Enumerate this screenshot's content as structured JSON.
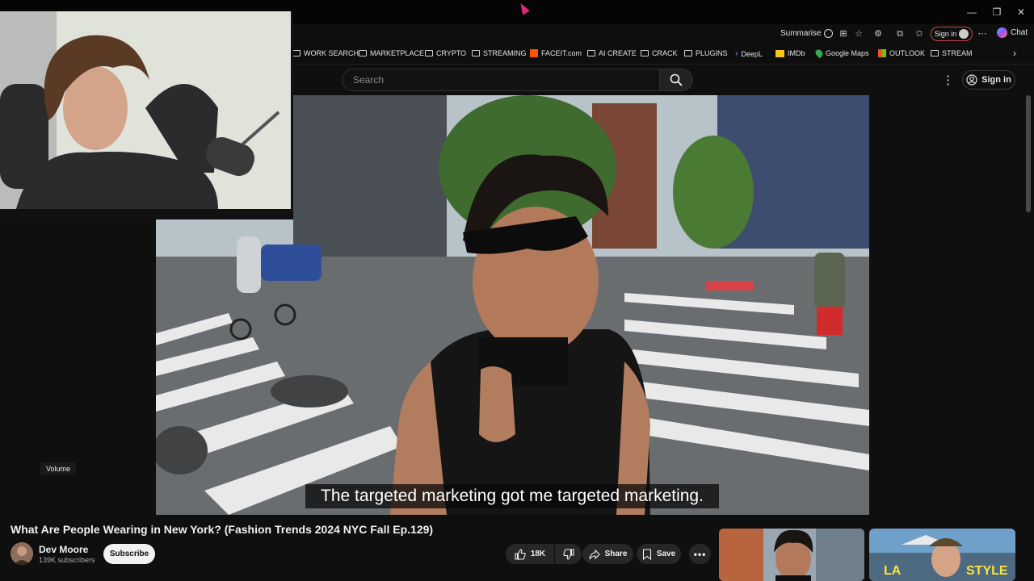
{
  "browser": {
    "toolbar": {
      "summarise_label": "Summarise",
      "signin_label": "Sign in",
      "chat_label": "Chat"
    },
    "bookmarks": [
      {
        "label": "WORK SEARCH",
        "icon": "folder-icon"
      },
      {
        "label": "MARKETPLACE",
        "icon": "folder-icon"
      },
      {
        "label": "CRYPTO",
        "icon": "folder-icon"
      },
      {
        "label": "STREAMING",
        "icon": "folder-icon"
      },
      {
        "label": "FACEIT.com",
        "icon": "faceit-icon"
      },
      {
        "label": "AI CREATE",
        "icon": "folder-icon"
      },
      {
        "label": "CRACK",
        "icon": "folder-icon"
      },
      {
        "label": "PLUGINS",
        "icon": "folder-icon"
      },
      {
        "label": "DeepL",
        "icon": "deepl-icon"
      },
      {
        "label": "IMDb",
        "icon": "imdb-icon"
      },
      {
        "label": "Google Maps",
        "icon": "maps-icon"
      },
      {
        "label": "OUTLOOK",
        "icon": "outlook-icon"
      },
      {
        "label": "STREAM",
        "icon": "folder-icon"
      }
    ]
  },
  "youtube": {
    "search_placeholder": "Search",
    "signin_label": "Sign in",
    "volume_tooltip": "Volume",
    "caption": "The targeted marketing got me targeted marketing.",
    "video_title": "What Are People Wearing in New York? (Fashion Trends 2024 NYC Fall Ep.129)",
    "channel_name": "Dev Moore",
    "subscribers": "139K subscribers",
    "subscribe_label": "Subscribe",
    "like_count": "18K",
    "share_label": "Share",
    "save_label": "Save",
    "recommended": [
      {
        "overlay_text": ""
      },
      {
        "overlay_text": "LA",
        "overlay_text_2": "STYLE"
      }
    ]
  },
  "colors": {
    "background": "#0f0f0f",
    "pill": "#272727",
    "accent_red": "#c0001a",
    "cursor": "#e0287a"
  }
}
